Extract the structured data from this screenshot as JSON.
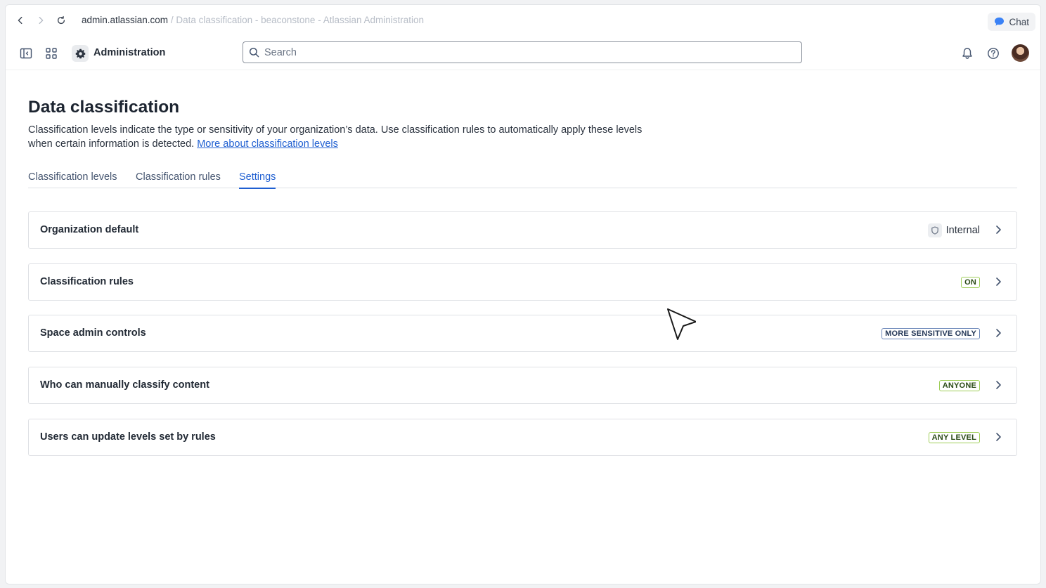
{
  "browser": {
    "url_domain": "admin.atlassian.com",
    "url_rest": "/ Data classification - beaconstone - Atlassian Administration",
    "chat_label": "Chat"
  },
  "header": {
    "app_title": "Administration",
    "search_placeholder": "Search"
  },
  "page": {
    "title": "Data classification",
    "description": "Classification levels indicate the type or sensitivity of your organization’s data. Use classification rules to automatically apply these levels when certain information is detected.",
    "learn_more_link": "More about classification levels"
  },
  "tabs": [
    {
      "label": "Classification levels",
      "active": false
    },
    {
      "label": "Classification rules",
      "active": false
    },
    {
      "label": "Settings",
      "active": true
    }
  ],
  "settings": [
    {
      "label": "Organization default",
      "value": "Internal",
      "value_type": "level"
    },
    {
      "label": "Classification rules",
      "value": "ON",
      "value_type": "lozenge-green"
    },
    {
      "label": "Space admin controls",
      "value": "MORE SENSITIVE ONLY",
      "value_type": "lozenge-blue"
    },
    {
      "label": "Who can manually classify content",
      "value": "ANYONE",
      "value_type": "lozenge-green"
    },
    {
      "label": "Users can update levels set by rules",
      "value": "ANY LEVEL",
      "value_type": "lozenge-green"
    }
  ],
  "colors": {
    "link": "#1f5fd1",
    "lozenge_green_border": "#9fce59",
    "lozenge_blue_border": "#6a86b8",
    "chat_icon": "#3b82f6"
  }
}
